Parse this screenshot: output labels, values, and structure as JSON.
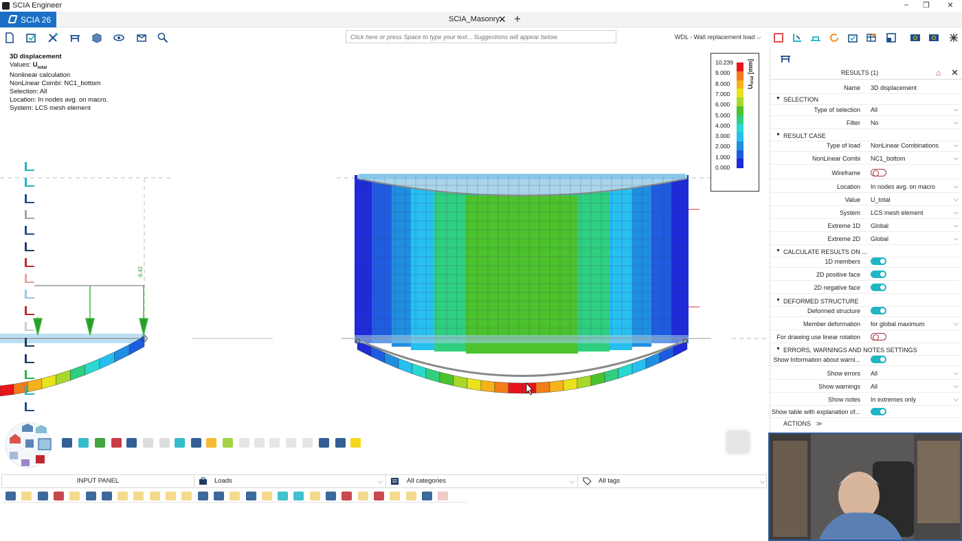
{
  "window": {
    "app_title": "SCIA Engineer",
    "minimize": "–",
    "maximize": "❐",
    "close": "✕"
  },
  "tabs": {
    "product": "SCIA 26",
    "document": "SCIA_Masonry",
    "close_symbol": "✕",
    "add_symbol": "+"
  },
  "toolbar": {
    "command_placeholder": "Click here or press Space to type your text... Suggestions will appear below.",
    "load_case": "WDL - Wall replacement load",
    "left_icons": [
      "new-file-icon",
      "open-icon",
      "tools-icon",
      "structure-icon",
      "view-3d-icon",
      "visibility-icon",
      "clip-icon",
      "zoom-icon"
    ],
    "right_icons": [
      "select-icon",
      "snap-icon",
      "grid-icon",
      "refresh-icon",
      "check-icon",
      "table-icon",
      "window-icon",
      "flag-icon",
      "flag-icon",
      "network-icon"
    ]
  },
  "viewport": {
    "info": {
      "title": "3D displacement",
      "values_label": "Values:",
      "values_value": "U",
      "values_sub": "total",
      "calc": "Nonlinear calculation",
      "combi": "NonLinear Combi: NC1_bottom",
      "selection": "Selection: All",
      "location": "Location: In nodes avg. on macro.",
      "system": "System: LCS mesh element"
    },
    "legend": {
      "unit_label": "U",
      "unit_sub": "total",
      "unit": "[mm]",
      "values": [
        "10.239",
        "9.000",
        "8.000",
        "7.000",
        "6.000",
        "5.000",
        "4.000",
        "3.000",
        "2.000",
        "1.000",
        "0.000"
      ],
      "colors": [
        "#e8141c",
        "#f27d1a",
        "#f5b21c",
        "#e9e21d",
        "#a7d82a",
        "#4cc22c",
        "#2fcf7f",
        "#29d8d0",
        "#26bff0",
        "#1f8ee0",
        "#1d5ce0",
        "#1f2ad8"
      ]
    },
    "dimension_label": "-9.42"
  },
  "input_panel": {
    "title": "INPUT PANEL",
    "category_select": "Loads",
    "filter_select": "All categories",
    "tags_select": "All tags"
  },
  "properties": {
    "header": "RESULTS (1)",
    "name_label": "Name",
    "name_value": "3D displacement",
    "sections": {
      "selection": "SELECTION",
      "result_case": "RESULT CASE",
      "calculate": "CALCULATE RESULTS ON ...",
      "deformed": "DEFORMED STRUCTURE",
      "errors": "ERRORS, WARNINGS AND NOTES SETTINGS"
    },
    "rows": {
      "type_of_selection": {
        "label": "Type of selection",
        "value": "All"
      },
      "filter": {
        "label": "Filter",
        "value": "No"
      },
      "type_of_load": {
        "label": "Type of load",
        "value": "NonLinear Combinations"
      },
      "nonlinear_combi": {
        "label": "NonLinear Combi",
        "value": "NC1_bottom"
      },
      "wireframe": {
        "label": "Wireframe"
      },
      "location": {
        "label": "Location",
        "value": "In nodes avg. on macro"
      },
      "value": {
        "label": "Value",
        "value": "U_total"
      },
      "system": {
        "label": "System",
        "value": "LCS mesh element"
      },
      "extreme_1d": {
        "label": "Extreme 1D",
        "value": "Global"
      },
      "extreme_2d": {
        "label": "Extreme 2D",
        "value": "Global"
      },
      "members_1d": {
        "label": "1D members"
      },
      "positive_face": {
        "label": "2D positive face"
      },
      "negative_face": {
        "label": "2D negative face"
      },
      "deformed_structure": {
        "label": "Deformed structure"
      },
      "member_deformation": {
        "label": "Member deformation",
        "value": "for global maximum"
      },
      "linear_rotation": {
        "label": "For drawing use linear rotation"
      },
      "show_info": {
        "label": "Show Information about warni..."
      },
      "show_errors": {
        "label": "Show errors",
        "value": "All"
      },
      "show_warnings": {
        "label": "Show warnings",
        "value": "All"
      },
      "show_notes": {
        "label": "Show notes",
        "value": "In extremes only"
      },
      "show_table": {
        "label": "Show table with explanation of..."
      }
    },
    "actions": "ACTIONS",
    "actions_arrow": "≫"
  }
}
